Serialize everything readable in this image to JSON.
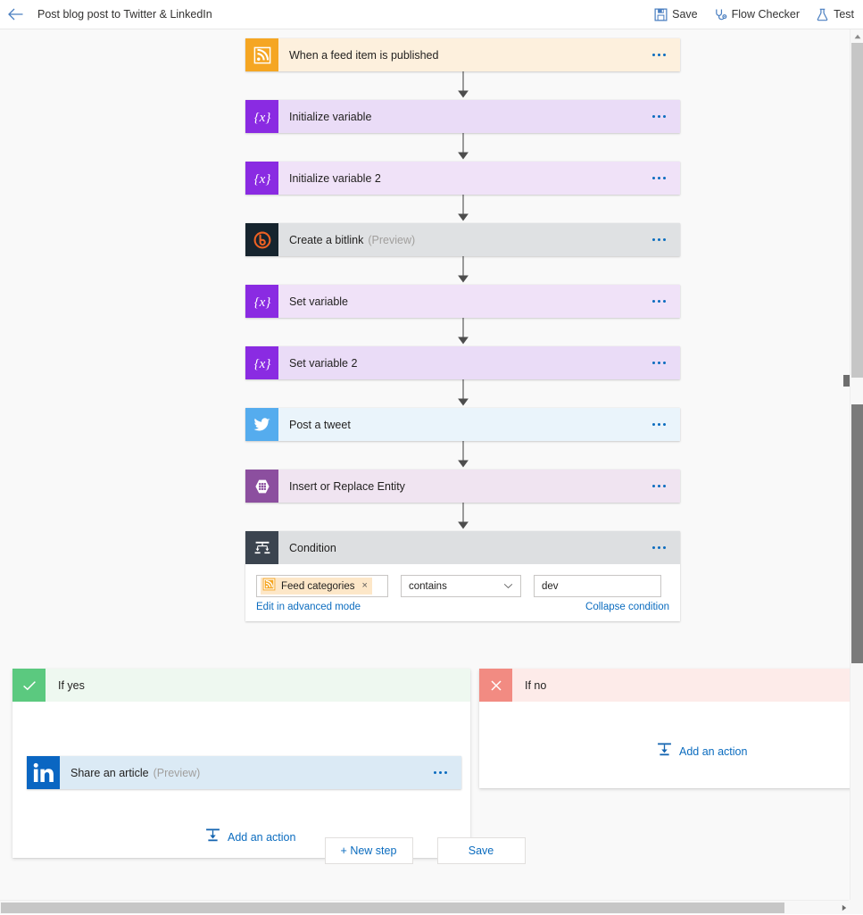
{
  "topbar": {
    "back_icon": "arrow-left-icon",
    "title": "Post blog post to Twitter & LinkedIn",
    "commands": [
      {
        "label": "Save",
        "icon": "save-floppy-icon"
      },
      {
        "label": "Flow Checker",
        "icon": "stethoscope-icon"
      },
      {
        "label": "Test",
        "icon": "flask-icon"
      }
    ]
  },
  "flow": {
    "steps": [
      {
        "title": "When a feed item is published",
        "sub": "",
        "icon": "rss-icon",
        "card_class": "bg-trigger",
        "name": "step-when-a-feed-item-is-published"
      },
      {
        "title": "Initialize variable",
        "sub": "",
        "icon": "variable-icon",
        "card_class": "bg-variable",
        "name": "step-initialize-variable"
      },
      {
        "title": "Initialize variable 2",
        "sub": "",
        "icon": "variable-icon",
        "card_class": "bg-variable2",
        "name": "step-initialize-variable-2"
      },
      {
        "title": "Create a bitlink",
        "sub": "(Preview)",
        "icon": "bitly-icon",
        "card_class": "bg-gray",
        "name": "step-create-a-bitlink"
      },
      {
        "title": "Set variable",
        "sub": "",
        "icon": "variable-icon",
        "card_class": "bg-variable2",
        "name": "step-set-variable"
      },
      {
        "title": "Set variable 2",
        "sub": "",
        "icon": "variable-icon",
        "card_class": "bg-variable",
        "name": "step-set-variable-2"
      },
      {
        "title": "Post a tweet",
        "sub": "",
        "icon": "twitter-icon",
        "card_class": "bg-twitter",
        "name": "step-post-a-tweet"
      },
      {
        "title": "Insert or Replace Entity",
        "sub": "",
        "icon": "azure-table-icon",
        "card_class": "bg-table",
        "name": "step-insert-or-replace-entity"
      }
    ]
  },
  "condition": {
    "title": "Condition",
    "icon": "condition-branch-icon",
    "token": {
      "label": "Feed categories",
      "icon": "rss-icon",
      "remove": "×"
    },
    "operator": "contains",
    "value": "dev",
    "advanced_link": "Edit in advanced mode",
    "collapse_link": "Collapse condition"
  },
  "branches": {
    "yes": {
      "label": "If yes",
      "badge_icon": "check-icon",
      "action": {
        "title": "Share an article",
        "sub": "(Preview)",
        "icon": "linkedin-icon",
        "card_class": "bg-linkedin"
      },
      "add_action_label": "Add an action",
      "add_action_icon": "add-action-icon"
    },
    "no": {
      "label": "If no",
      "badge_icon": "close-x-icon",
      "add_action_label": "Add an action",
      "add_action_icon": "add-action-icon"
    }
  },
  "bottom": {
    "new_step_label": "+ New step",
    "save_label": "Save"
  },
  "colors": {
    "accent_blue": "#0b6cbf",
    "trigger_peach": "#fdf0dd",
    "variable_purple": "#8a2be2",
    "yes_green": "#5bc97f",
    "no_red": "#f28b82",
    "canvas": "#f9f9f9"
  }
}
